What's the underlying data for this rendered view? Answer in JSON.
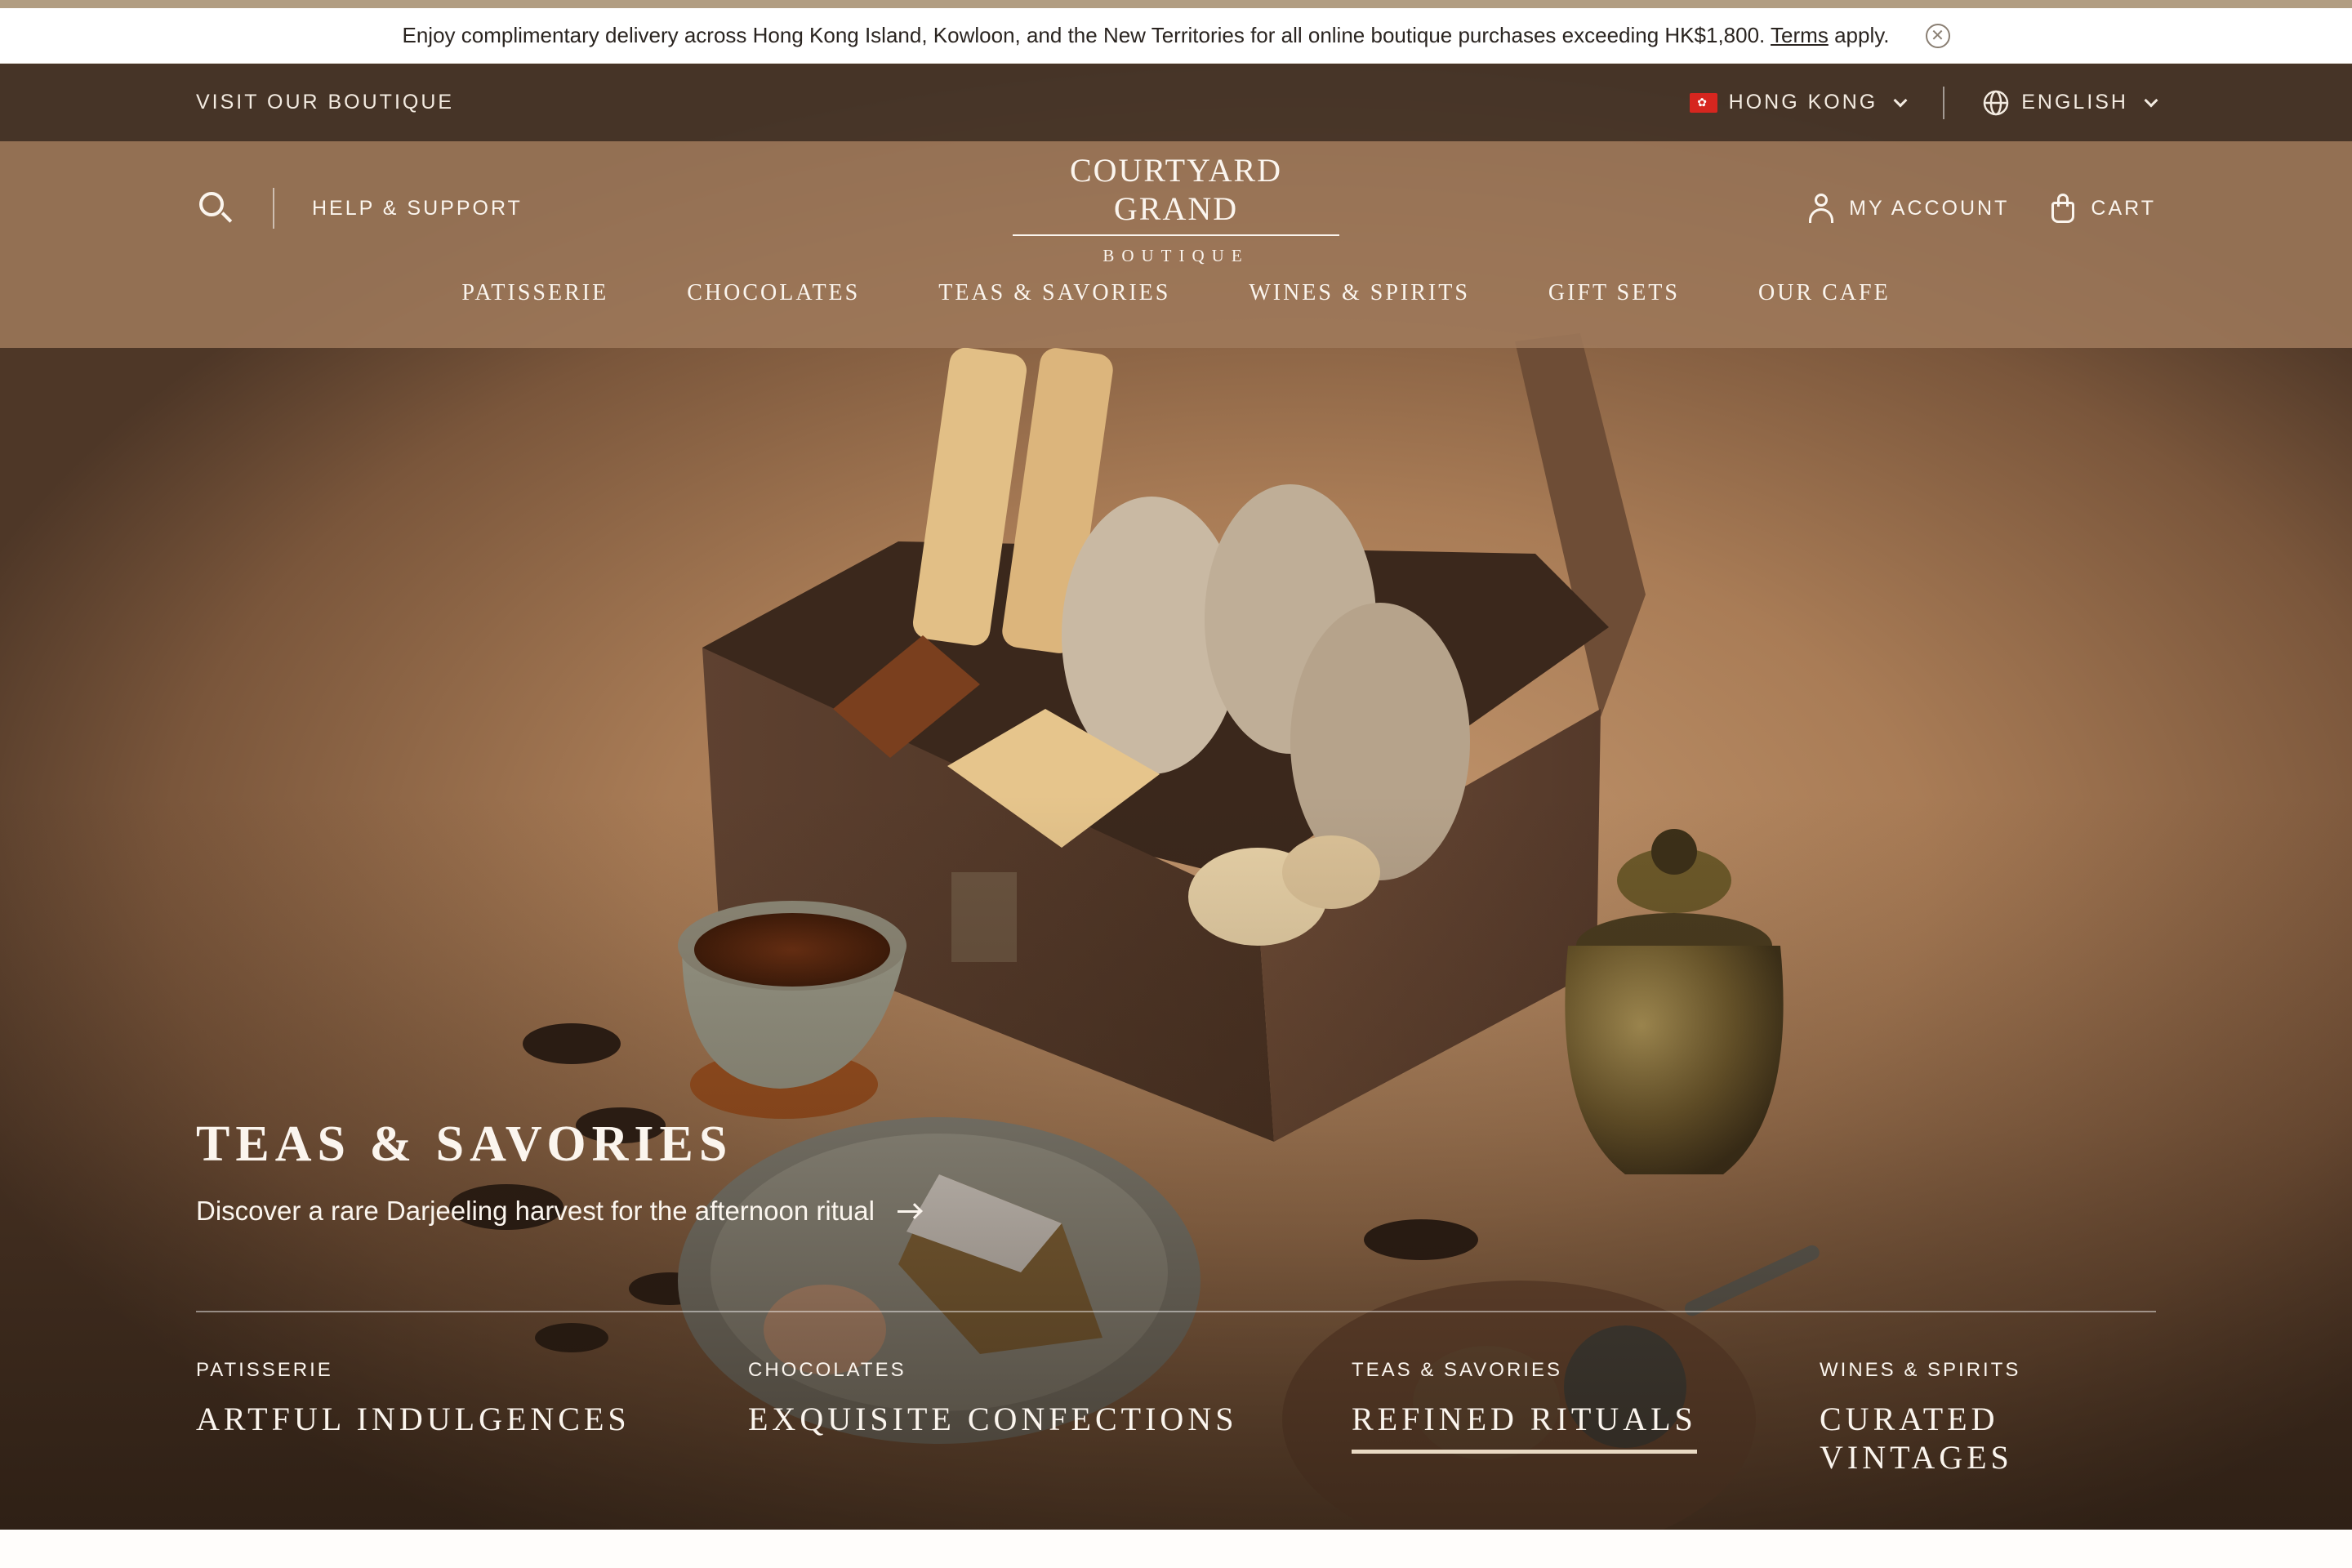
{
  "announcement": {
    "text": "Enjoy complimentary delivery across Hong Kong Island, Kowloon, and the New Territories for all online boutique purchases exceeding HK$1,800.",
    "terms_label": "Terms",
    "suffix": "apply.",
    "close_icon": "close-icon"
  },
  "utility_bar": {
    "visit_label": "VISIT OUR BOUTIQUE",
    "region_label": "HONG KONG",
    "language_label": "ENGLISH"
  },
  "header": {
    "help_label": "HELP & SUPPORT",
    "logo_name": "COURTYARD GRAND",
    "logo_sub": "BOUTIQUE",
    "account_label": "MY ACCOUNT",
    "cart_label": "CART"
  },
  "nav": {
    "items": [
      {
        "label": "PATISSERIE"
      },
      {
        "label": "CHOCOLATES"
      },
      {
        "label": "TEAS & SAVORIES"
      },
      {
        "label": "WINES & SPIRITS"
      },
      {
        "label": "GIFT SETS"
      },
      {
        "label": "OUR CAFE"
      }
    ]
  },
  "hero": {
    "title": "TEAS & SAVORIES",
    "link_text": "Discover a rare Darjeeling harvest for the afternoon ritual"
  },
  "tiles": [
    {
      "eyebrow": "PATISSERIE",
      "headline": "ARTFUL INDULGENCES",
      "active": false
    },
    {
      "eyebrow": "CHOCOLATES",
      "headline": "EXQUISITE CONFECTIONS",
      "active": false
    },
    {
      "eyebrow": "TEAS & SAVORIES",
      "headline": "REFINED RITUALS",
      "active": true
    },
    {
      "eyebrow": "WINES & SPIRITS",
      "headline": "CURATED VINTAGES",
      "active": false
    }
  ],
  "colors": {
    "accent_bar": "#b19d82",
    "utility_bg": "#463428",
    "header_bg": "#a07a5c",
    "text_light": "#fbf5ee"
  }
}
